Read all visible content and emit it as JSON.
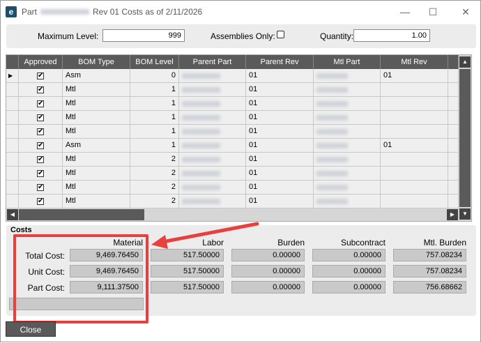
{
  "window": {
    "title_prefix": "Part",
    "title_suffix": "Rev 01 Costs as of 2/11/2026",
    "minimize": "—",
    "maximize": "☐",
    "close": "✕"
  },
  "params": {
    "max_level_label": "Maximum Level:",
    "max_level_value": "999",
    "assemblies_only_label": "Assemblies Only:",
    "assemblies_only_checked": false,
    "quantity_label": "Quantity:",
    "quantity_value": "1.00"
  },
  "grid": {
    "columns": [
      "Approved",
      "BOM Type",
      "BOM Level",
      "Parent Part",
      "Parent Rev",
      "Mtl Part",
      "Mtl Rev"
    ],
    "rows": [
      {
        "approved": true,
        "bom_type": "Asm",
        "bom_level": "0",
        "parent_rev": "01",
        "mtl_rev": "01"
      },
      {
        "approved": true,
        "bom_type": "Mtl",
        "bom_level": "1",
        "parent_rev": "01",
        "mtl_rev": ""
      },
      {
        "approved": true,
        "bom_type": "Mtl",
        "bom_level": "1",
        "parent_rev": "01",
        "mtl_rev": ""
      },
      {
        "approved": true,
        "bom_type": "Mtl",
        "bom_level": "1",
        "parent_rev": "01",
        "mtl_rev": ""
      },
      {
        "approved": true,
        "bom_type": "Mtl",
        "bom_level": "1",
        "parent_rev": "01",
        "mtl_rev": ""
      },
      {
        "approved": true,
        "bom_type": "Asm",
        "bom_level": "1",
        "parent_rev": "01",
        "mtl_rev": "01"
      },
      {
        "approved": true,
        "bom_type": "Mtl",
        "bom_level": "2",
        "parent_rev": "01",
        "mtl_rev": ""
      },
      {
        "approved": true,
        "bom_type": "Mtl",
        "bom_level": "2",
        "parent_rev": "01",
        "mtl_rev": ""
      },
      {
        "approved": true,
        "bom_type": "Mtl",
        "bom_level": "2",
        "parent_rev": "01",
        "mtl_rev": ""
      },
      {
        "approved": true,
        "bom_type": "Mtl",
        "bom_level": "2",
        "parent_rev": "01",
        "mtl_rev": ""
      }
    ]
  },
  "costs": {
    "title": "Costs",
    "columns": [
      "Material",
      "Labor",
      "Burden",
      "Subcontract",
      "Mtl. Burden"
    ],
    "rows": [
      {
        "label": "Total Cost:",
        "values": [
          "9,469.76450",
          "517.50000",
          "0.00000",
          "0.00000",
          "757.08234"
        ]
      },
      {
        "label": "Unit Cost:",
        "values": [
          "9,469.76450",
          "517.50000",
          "0.00000",
          "0.00000",
          "757.08234"
        ]
      },
      {
        "label": "Part Cost:",
        "values": [
          "9,111.37500",
          "517.50000",
          "0.00000",
          "0.00000",
          "756.68662"
        ]
      }
    ]
  },
  "close_label": "Close",
  "annotation_color": "#e8403f"
}
